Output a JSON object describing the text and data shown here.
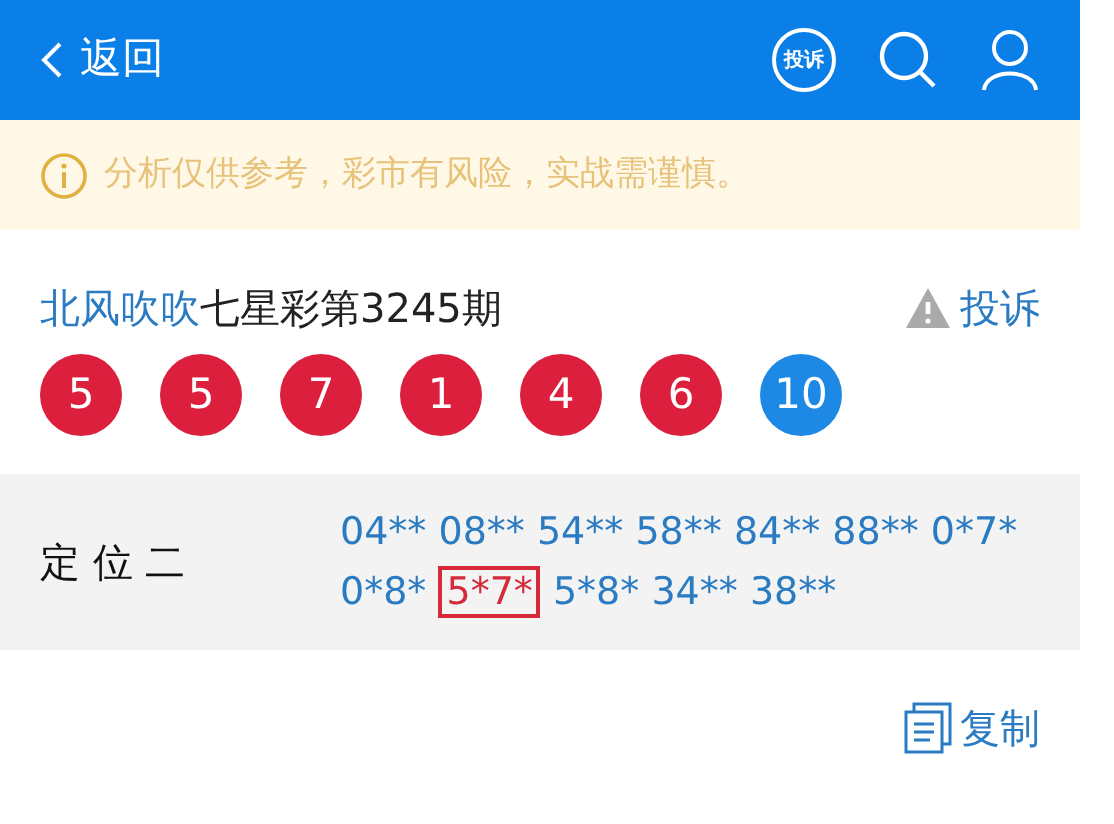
{
  "header": {
    "back_label": "返回",
    "complaint_badge": "投诉"
  },
  "notice": {
    "text": "分析仅供参考，彩市有风险，实战需谨慎。"
  },
  "post": {
    "author": "北风吹吹",
    "title": "七星彩第3245期",
    "complaint_label": "投诉"
  },
  "balls": [
    {
      "number": "5",
      "kind": "red"
    },
    {
      "number": "5",
      "kind": "red"
    },
    {
      "number": "7",
      "kind": "red"
    },
    {
      "number": "1",
      "kind": "red"
    },
    {
      "number": "4",
      "kind": "red"
    },
    {
      "number": "6",
      "kind": "red"
    },
    {
      "number": "10",
      "kind": "blue"
    }
  ],
  "prediction": {
    "label": "定 位 二",
    "codes": [
      {
        "code": "04**",
        "hit": false
      },
      {
        "code": "08**",
        "hit": false
      },
      {
        "code": "54**",
        "hit": false
      },
      {
        "code": "58**",
        "hit": false
      },
      {
        "code": "84**",
        "hit": false
      },
      {
        "code": "88**",
        "hit": false
      },
      {
        "code": "0*7*",
        "hit": false
      },
      {
        "code": "0*8*",
        "hit": false
      },
      {
        "code": "5*7*",
        "hit": true
      },
      {
        "code": "5*8*",
        "hit": false
      },
      {
        "code": "34**",
        "hit": false
      },
      {
        "code": "38**",
        "hit": false
      }
    ]
  },
  "copy_label": "复制"
}
